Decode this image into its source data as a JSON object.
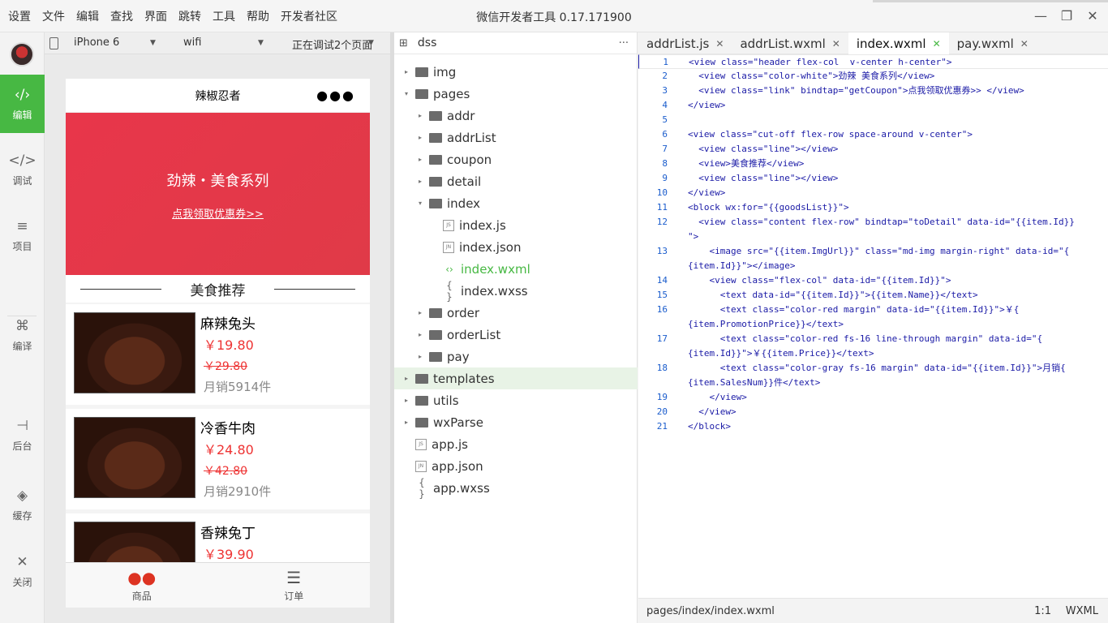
{
  "menu": [
    "设置",
    "文件",
    "编辑",
    "查找",
    "界面",
    "跳转",
    "工具",
    "帮助",
    "开发者社区"
  ],
  "app_title": "微信开发者工具 0.17.171900",
  "left_nav": [
    {
      "label": "编辑",
      "icon": "edit-icon",
      "glyph": "‹/›"
    },
    {
      "label": "调试",
      "icon": "debug-icon",
      "glyph": "</>"
    },
    {
      "label": "项目",
      "icon": "project-icon",
      "glyph": "≡"
    },
    {
      "label": "编译",
      "icon": "compile-icon",
      "glyph": "⌘"
    },
    {
      "label": "后台",
      "icon": "background-icon",
      "glyph": "⊣"
    },
    {
      "label": "缓存",
      "icon": "cache-icon",
      "glyph": "◈"
    },
    {
      "label": "关闭",
      "icon": "close-icon",
      "glyph": "✕"
    }
  ],
  "sim_toolbar": {
    "device": "iPhone 6",
    "network": "wifi",
    "debug": "正在调试2个页面"
  },
  "phone": {
    "title": "辣椒忍者",
    "banner_title": "劲辣・美食系列",
    "banner_link": "点我领取优惠券>>",
    "section_title": "美食推荐",
    "goods": [
      {
        "name": "麻辣兔头",
        "price": "￥19.80",
        "old_price": "￥29.80",
        "sales": "月销5914件"
      },
      {
        "name": "冷香牛肉",
        "price": "￥24.80",
        "old_price": "￥42.80",
        "sales": "月销2910件"
      },
      {
        "name": "香辣兔丁",
        "price": "￥39.90",
        "old_price": "",
        "sales": ""
      }
    ],
    "tabs": [
      {
        "label": "商品",
        "glyph": "●●"
      },
      {
        "label": "订单",
        "glyph": "☰"
      }
    ]
  },
  "filetree": {
    "root": "dss",
    "rows": [
      {
        "name": "img",
        "type": "folder",
        "arrow": "▸",
        "indent": 0
      },
      {
        "name": "pages",
        "type": "folder",
        "arrow": "▾",
        "indent": 0
      },
      {
        "name": "addr",
        "type": "folder",
        "arrow": "▸",
        "indent": 1
      },
      {
        "name": "addrList",
        "type": "folder",
        "arrow": "▸",
        "indent": 1
      },
      {
        "name": "coupon",
        "type": "folder",
        "arrow": "▸",
        "indent": 1
      },
      {
        "name": "detail",
        "type": "folder",
        "arrow": "▸",
        "indent": 1
      },
      {
        "name": "index",
        "type": "folder",
        "arrow": "▾",
        "indent": 1
      },
      {
        "name": "index.js",
        "type": "JS",
        "arrow": "",
        "indent": 2
      },
      {
        "name": "index.json",
        "type": "JN",
        "arrow": "",
        "indent": 2
      },
      {
        "name": "index.wxml",
        "type": "code",
        "arrow": "",
        "indent": 2,
        "active": true
      },
      {
        "name": "index.wxss",
        "type": "brace",
        "arrow": "",
        "indent": 2
      },
      {
        "name": "order",
        "type": "folder",
        "arrow": "▸",
        "indent": 1
      },
      {
        "name": "orderList",
        "type": "folder",
        "arrow": "▸",
        "indent": 1
      },
      {
        "name": "pay",
        "type": "folder",
        "arrow": "▸",
        "indent": 1
      },
      {
        "name": "templates",
        "type": "folder",
        "arrow": "▸",
        "indent": 0,
        "highlight": true
      },
      {
        "name": "utils",
        "type": "folder",
        "arrow": "▸",
        "indent": 0
      },
      {
        "name": "wxParse",
        "type": "folder",
        "arrow": "▸",
        "indent": 0
      },
      {
        "name": "app.js",
        "type": "JS",
        "arrow": "",
        "indent": 0
      },
      {
        "name": "app.json",
        "type": "JN",
        "arrow": "",
        "indent": 0
      },
      {
        "name": "app.wxss",
        "type": "brace",
        "arrow": "",
        "indent": 0
      }
    ]
  },
  "editor_tabs": [
    {
      "label": "addrList.js",
      "active": false
    },
    {
      "label": "addrList.wxml",
      "active": false
    },
    {
      "label": "index.wxml",
      "active": true
    },
    {
      "label": "pay.wxml",
      "active": false
    }
  ],
  "code_lines": [
    {
      "n": "1",
      "t": "<view class=\"header flex-col  v-center h-center\">"
    },
    {
      "n": "2",
      "t": "  <view class=\"color-white\">劲辣 美食系列</view>"
    },
    {
      "n": "3",
      "t": "  <view class=\"link\" bindtap=\"getCoupon\">点我领取优惠券>> </view>"
    },
    {
      "n": "4",
      "t": "</view>"
    },
    {
      "n": "5",
      "t": ""
    },
    {
      "n": "6",
      "t": "<view class=\"cut-off flex-row space-around v-center\">"
    },
    {
      "n": "7",
      "t": "  <view class=\"line\"></view>"
    },
    {
      "n": "8",
      "t": "  <view>美食推荐</view>"
    },
    {
      "n": "9",
      "t": "  <view class=\"line\"></view>"
    },
    {
      "n": "10",
      "t": "</view>"
    },
    {
      "n": "11",
      "t": "<block wx:for=\"{{goodsList}}\">"
    },
    {
      "n": "12",
      "t": "  <view class=\"content flex-row\" bindtap=\"toDetail\" data-id=\"{{item.Id}}"
    },
    {
      "n": "",
      "t": "\">"
    },
    {
      "n": "13",
      "t": "    <image src=\"{{item.ImgUrl}}\" class=\"md-img margin-right\" data-id=\"{"
    },
    {
      "n": "",
      "t": "{item.Id}}\"></image>"
    },
    {
      "n": "14",
      "t": "    <view class=\"flex-col\" data-id=\"{{item.Id}}\">"
    },
    {
      "n": "15",
      "t": "      <text data-id=\"{{item.Id}}\">{{item.Name}}</text>"
    },
    {
      "n": "16",
      "t": "      <text class=\"color-red margin\" data-id=\"{{item.Id}}\">￥{"
    },
    {
      "n": "",
      "t": "{item.PromotionPrice}}</text>"
    },
    {
      "n": "17",
      "t": "      <text class=\"color-red fs-16 line-through margin\" data-id=\"{"
    },
    {
      "n": "",
      "t": "{item.Id}}\">￥{{item.Price}}</text>"
    },
    {
      "n": "18",
      "t": "      <text class=\"color-gray fs-16 margin\" data-id=\"{{item.Id}}\">月销{"
    },
    {
      "n": "",
      "t": "{item.SalesNum}}件</text>"
    },
    {
      "n": "19",
      "t": "    </view>"
    },
    {
      "n": "20",
      "t": "  </view>"
    },
    {
      "n": "21",
      "t": "</block>"
    }
  ],
  "status": {
    "path": "pages/index/index.wxml",
    "position": "1:1",
    "language": "WXML"
  },
  "colors": {
    "accent": "#47b843",
    "banner": "#e8364a",
    "price": "#e33"
  }
}
